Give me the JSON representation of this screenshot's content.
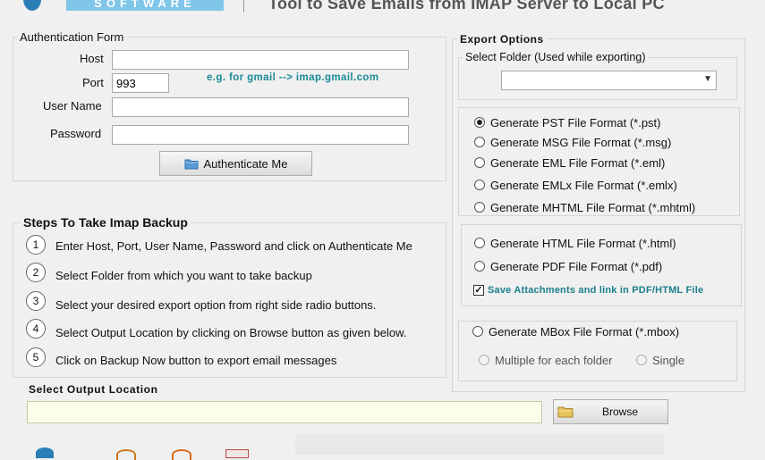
{
  "header": {
    "brand": "SOFTWARE",
    "title": "Tool to Save Emails from IMAP Server to Local PC"
  },
  "auth": {
    "legend": "Authentication Form",
    "host_label": "Host",
    "host_value": "",
    "port_label": "Port",
    "port_value": "993",
    "user_label": "User Name",
    "user_value": "",
    "password_label": "Password",
    "password_value": "",
    "hint": "e.g. for gmail -->  imap.gmail.com",
    "button": "Authenticate Me"
  },
  "steps": {
    "title": "Steps To Take Imap Backup",
    "items": [
      {
        "num": "1",
        "text": "Enter Host, Port, User Name, Password and click on Authenticate Me"
      },
      {
        "num": "2",
        "text": "Select Folder from which you want to take backup"
      },
      {
        "num": "3",
        "text": "Select your desired export option from right side radio buttons."
      },
      {
        "num": "4",
        "text": "Select Output Location by clicking on Browse button as given below."
      },
      {
        "num": "5",
        "text": "Click on Backup Now button to export email messages"
      }
    ]
  },
  "export": {
    "legend": "Export Options",
    "folder_legend": "Select Folder (Used while exporting)",
    "folder_selected": "",
    "formats": [
      {
        "label": "Generate PST File Format (*.pst)",
        "checked": true
      },
      {
        "label": "Generate MSG File Format (*.msg)",
        "checked": false
      },
      {
        "label": "Generate EML File Format (*.eml)",
        "checked": false
      },
      {
        "label": "Generate EMLx File Format  (*.emlx)",
        "checked": false
      },
      {
        "label": "Generate MHTML File Format (*.mhtml)",
        "checked": false
      }
    ],
    "doc_formats": [
      {
        "label": "Generate HTML File Format (*.html)",
        "checked": false
      },
      {
        "label": "Generate PDF File Format (*.pdf)",
        "checked": false
      }
    ],
    "save_attachments": {
      "label": "Save Attachments and link in PDF/HTML File",
      "checked": true
    },
    "mbox": {
      "label": "Generate MBox File Format (*.mbox)",
      "checked": false
    },
    "mbox_options": [
      {
        "label": "Multiple for each folder",
        "checked": false
      },
      {
        "label": "Single",
        "checked": false
      }
    ]
  },
  "output": {
    "label": "Select  Output Location",
    "value": "",
    "browse": "Browse"
  },
  "colors": {
    "accent": "#1b8a98",
    "brand": "#7fc6e8",
    "output_bg": "#fcfdea"
  }
}
